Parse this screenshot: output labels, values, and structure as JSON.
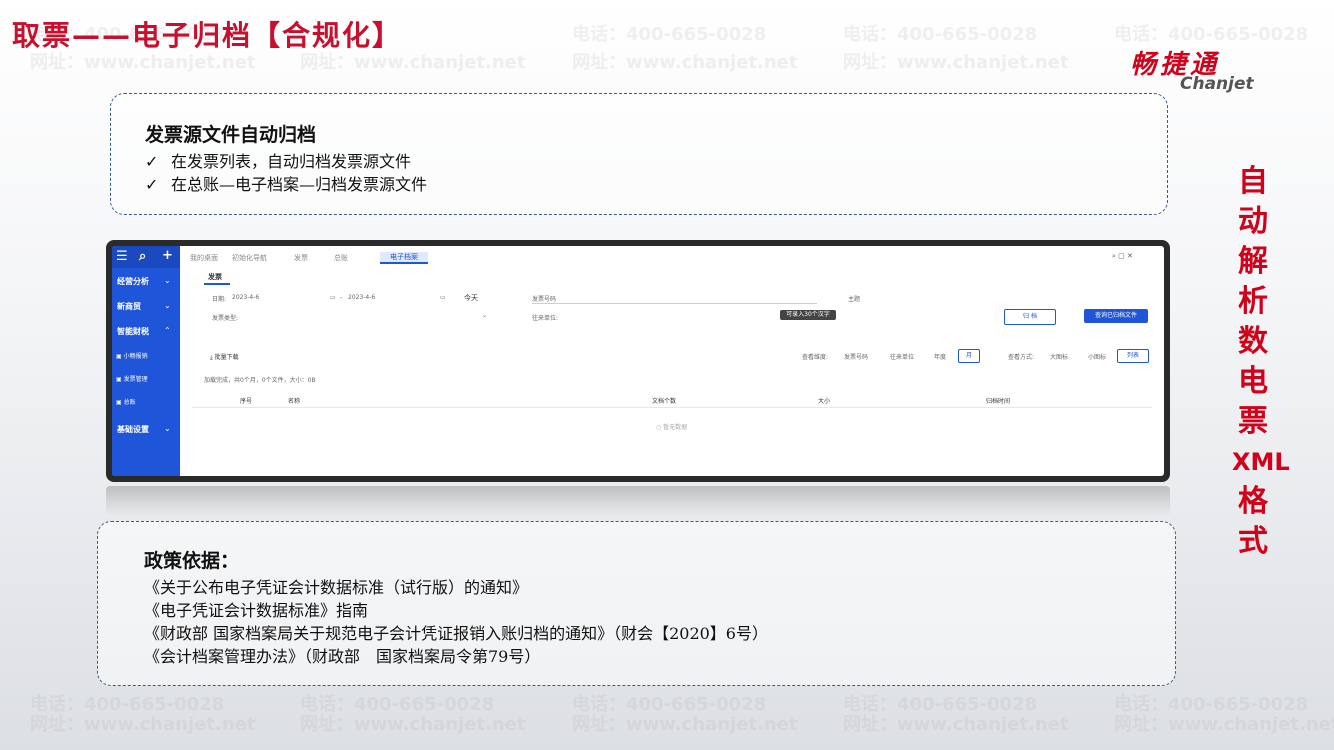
{
  "slide_title": "取票——电子归档【合规化】",
  "logo": {
    "cn": "畅捷通",
    "en": "Chanjet"
  },
  "watermark": {
    "phone": "电话：400-665-0028",
    "site": "网址：www.chanjet.net"
  },
  "box1": {
    "title": "发票源文件自动归档",
    "items": [
      "在发票列表，自动归档发票源文件",
      "在总账—电子档案—归档发票源文件"
    ]
  },
  "vertical_label": [
    "自",
    "动",
    "解",
    "析",
    "数",
    "电",
    "票",
    "XML",
    "格",
    "式"
  ],
  "app": {
    "tabs": [
      "我的桌面",
      "初始化导航",
      "发票",
      "总账"
    ],
    "active_tab": "电子档案",
    "subtab": "发票",
    "sidebar": {
      "groups": [
        "经营分析",
        "新商贸",
        "智能财税",
        "基础设置"
      ],
      "subitems": [
        "小畅报销",
        "发票管理",
        "总账"
      ]
    },
    "filters": {
      "date_label": "日期:",
      "date_from": "2023-4-6",
      "date_to": "2023-4-6",
      "date_preset": "今天",
      "invoice_no": "发票号码",
      "subject": "主题",
      "invoice_type": "发票类型:",
      "partner": "往来单位:",
      "tooltip": "可录入30个汉字"
    },
    "buttons": {
      "archive": "归 档",
      "view_archived": "查询已归档文件"
    },
    "download": "批量下载",
    "view_dim": {
      "label": "查看维度:",
      "options": [
        "发票号码",
        "往来单位",
        "年度"
      ],
      "selected": "月"
    },
    "view_mode": {
      "label": "查看方式:",
      "options": [
        "大图标",
        "小图标"
      ],
      "selected": "列表"
    },
    "load_status": "加载完成，共0个月，0个文件，大小：0B",
    "columns": [
      "序号",
      "名称",
      "文档个数",
      "大小",
      "归档时间"
    ],
    "empty": "暂无数据"
  },
  "box2": {
    "title": "政策依据：",
    "lines": [
      "《关于公布电子凭证会计数据标准（试行版）的通知》",
      "《电子凭证会计数据标准》指南",
      "《财政部 国家档案局关于规范电子会计凭证报销入账归档的通知》（财会【2020】6号）",
      "《会计档案管理办法》（财政部　国家档案局令第79号）"
    ]
  }
}
